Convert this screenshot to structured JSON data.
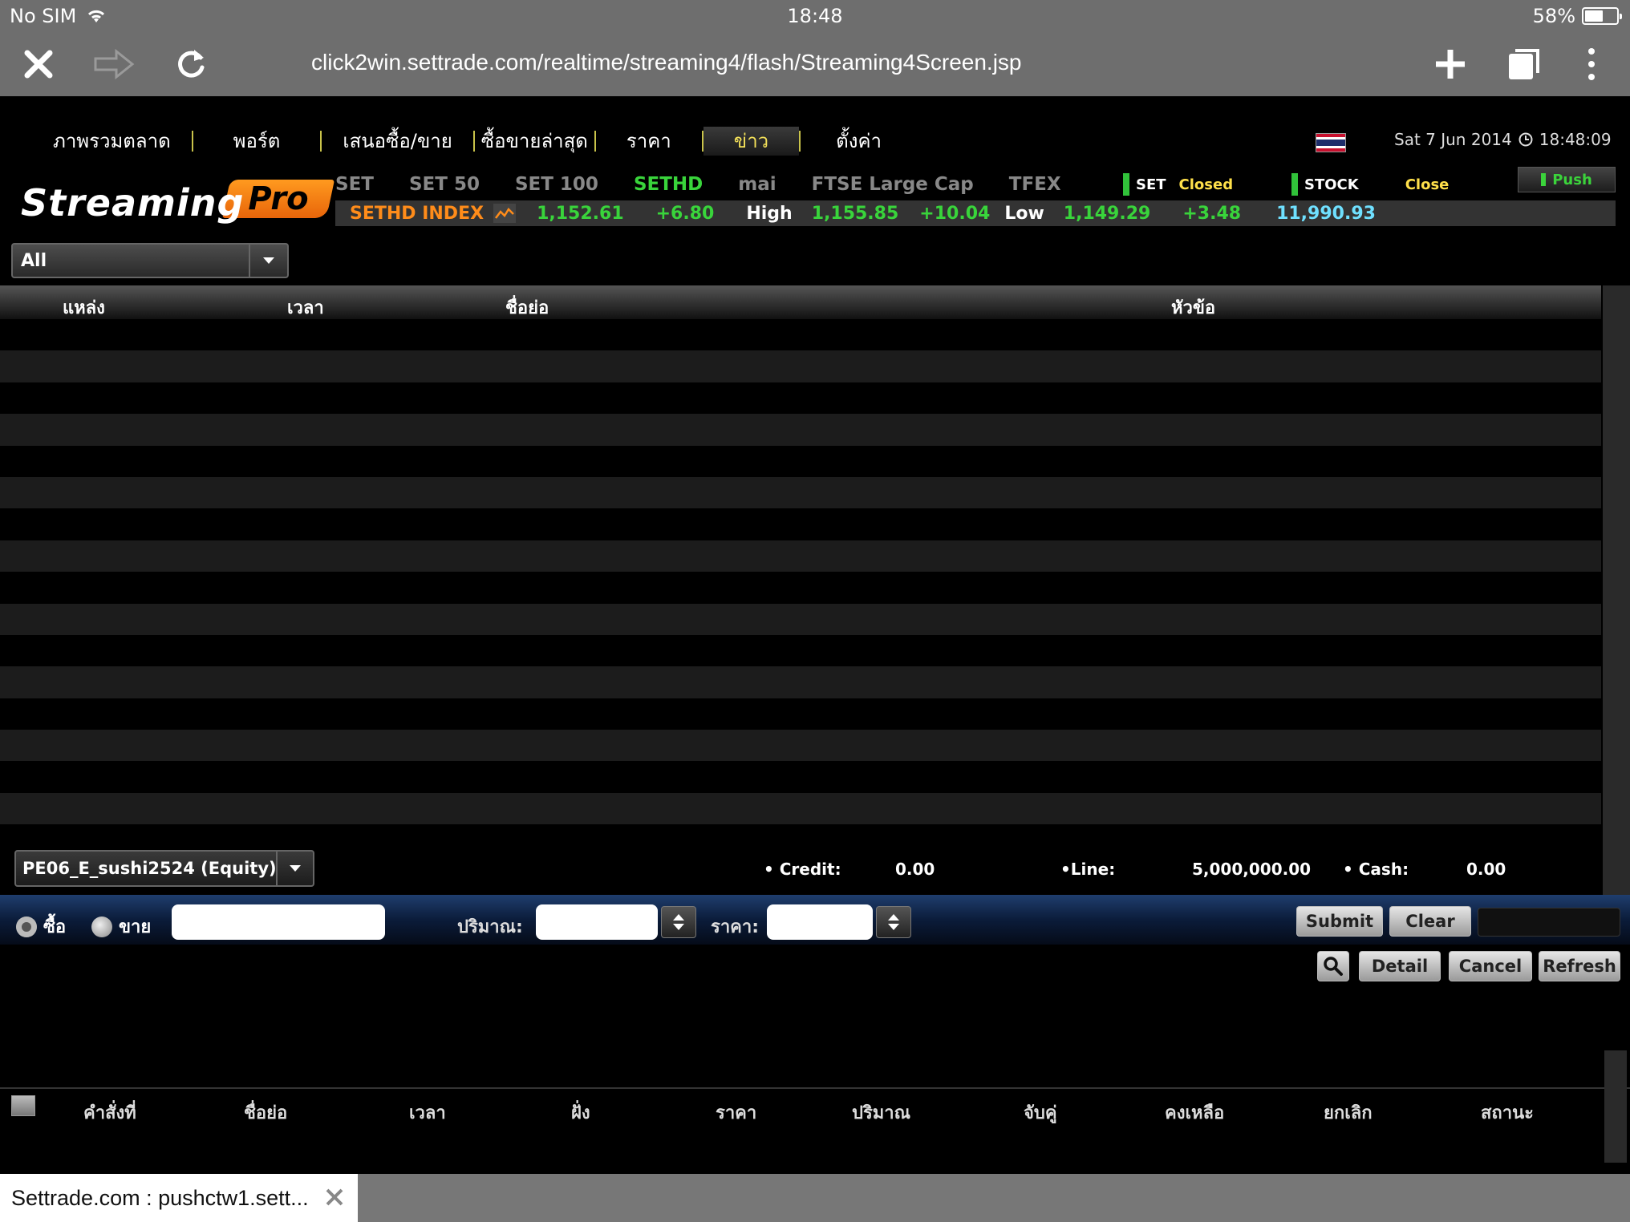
{
  "status": {
    "carrier": "No SIM",
    "time": "18:48",
    "battery": "58%",
    "battery_level": 0.58
  },
  "browser": {
    "url": "click2win.settrade.com/realtime/streaming4/flash/Streaming4Screen.jsp"
  },
  "menu": {
    "items": [
      {
        "label": "ภาพรวมตลาด"
      },
      {
        "label": "พอร์ต"
      },
      {
        "label": "เสนอซื้อ/ขาย"
      },
      {
        "label": "ซื้อขายล่าสุด"
      },
      {
        "label": "ราคา"
      },
      {
        "label": "ข่าว"
      },
      {
        "label": "ตั้งค่า"
      }
    ],
    "active": "ข่าว"
  },
  "datetime": "Sat 7 Jun 2014",
  "clock": "18:48:09",
  "logo": {
    "word": "Streaming",
    "badge": "Pro"
  },
  "index_tabs": [
    "SET",
    "SET 50",
    "SET 100",
    "SETHD",
    "mai",
    "FTSE Large Cap",
    "TFEX"
  ],
  "market_status": {
    "set_label": "SET",
    "set_state": "Closed",
    "stock_label": "STOCK",
    "stock_state": "Close",
    "push_label": "Push"
  },
  "ticker": {
    "name": "SETHD INDEX",
    "last": "1,152.61",
    "change": "+6.80",
    "high_label": "High",
    "high": "1,155.85",
    "high_change": "+10.04",
    "low_label": "Low",
    "low": "1,149.29",
    "low_change": "+3.48",
    "volume": "11,990.93"
  },
  "news": {
    "filter": "All",
    "columns": {
      "source": "แหล่ง",
      "time": "เวลา",
      "symbol": "ชื่อย่อ",
      "headline": "หัวข้อ"
    }
  },
  "account": {
    "name": "PE06_E_sushi2524 (Equity)",
    "credit_label": "Credit:",
    "credit": "0.00",
    "line_label": "Line:",
    "line": "5,000,000.00",
    "cash_label": "Cash:",
    "cash": "0.00"
  },
  "order": {
    "buy_label": "ซื้อ",
    "sell_label": "ขาย",
    "volume_label": "ปริมาณ:",
    "price_label": "ราคา:",
    "submit": "Submit",
    "clear": "Clear",
    "detail": "Detail",
    "cancel": "Cancel",
    "refresh": "Refresh"
  },
  "order_columns": [
    "คำสั่งที่",
    "ชื่อย่อ",
    "เวลา",
    "ฝั่ง",
    "ราคา",
    "ปริมาณ",
    "จับคู่",
    "คงเหลือ",
    "ยกเลิก",
    "สถานะ"
  ],
  "tab": {
    "title": "Settrade.com : pushctw1.sett..."
  },
  "colors": {
    "green": "#39d43b",
    "orange": "#ff8c1a",
    "yellow": "#ffe04a",
    "cyan": "#6fe0ff"
  }
}
